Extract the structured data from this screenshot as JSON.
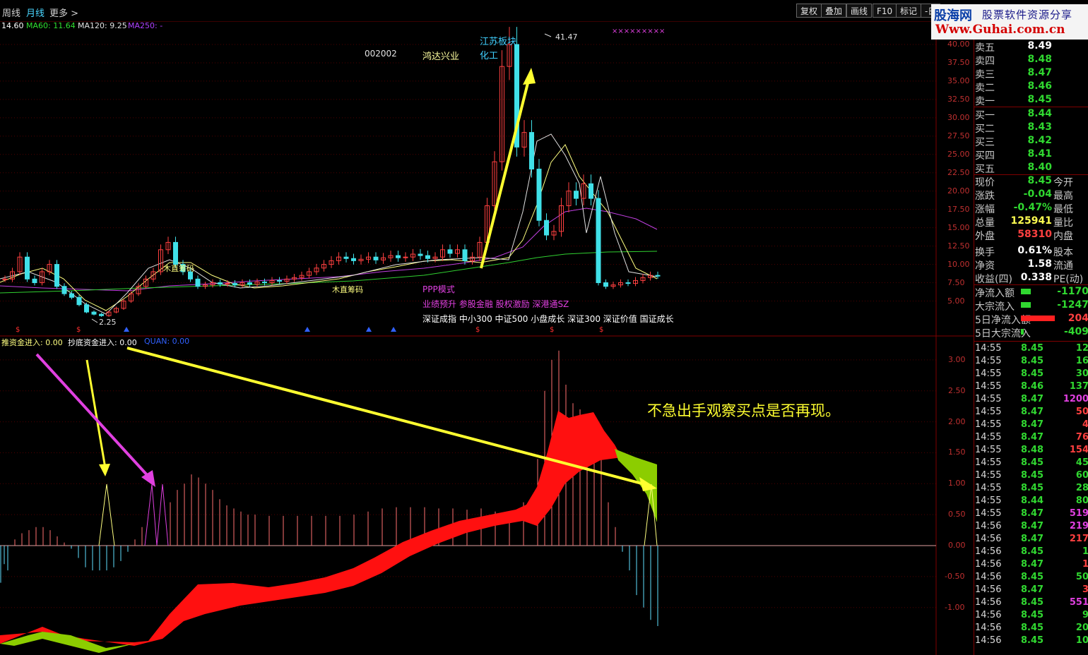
{
  "toolbar": {
    "tabs": [
      "周线",
      "月线",
      "更多 >"
    ],
    "buttons": [
      "复权",
      "叠加",
      "画线",
      "F10",
      "标记",
      "-日"
    ]
  },
  "logo": {
    "site": "股海网",
    "slogan": "股票软件资源分享",
    "url": "Www.Guhai.com.cn"
  },
  "ma_legend": {
    "ma30": "14.60",
    "ma60": "MA60: 11.64",
    "ma120": "MA120: 9.25",
    "ma250": "MA250: -"
  },
  "stock": {
    "code": "002002",
    "name": "鸿达兴业",
    "board": "江苏板块",
    "industry": "化工",
    "high_mark": "41.47",
    "low_mark": "2.25"
  },
  "annotations": {
    "label_a": "木直筹码",
    "label_b": "木直筹码",
    "ppp": "PPP模式",
    "concepts": "业绩预升 参股金融 股权激励 深港通SZ",
    "indices": "深证成指 中小300 中证500 小盘成长 深证300 深证价值 国证成长",
    "marks": "×××××××××",
    "comment": "不急出手观察买点是否再现。"
  },
  "indicator_legend": {
    "a": "推资金进入: 0.00",
    "b": "抄底资金进入: 0.00",
    "c": "QUAN: 0.00"
  },
  "price_axis": [
    "40.00",
    "37.50",
    "35.00",
    "32.50",
    "30.00",
    "27.50",
    "25.00",
    "22.50",
    "20.00",
    "17.50",
    "15.00",
    "12.50",
    "10.00",
    "7.50",
    "5.00"
  ],
  "ind_axis": [
    "3.00",
    "2.50",
    "2.00",
    "1.50",
    "1.00",
    "0.50",
    "0.00",
    "-0.50",
    "-1.00"
  ],
  "order_book": {
    "sell": [
      {
        "n": "卖五",
        "v": "8.49"
      },
      {
        "n": "卖四",
        "v": "8.48"
      },
      {
        "n": "卖三",
        "v": "8.47"
      },
      {
        "n": "卖二",
        "v": "8.46"
      },
      {
        "n": "卖一",
        "v": "8.45"
      }
    ],
    "buy": [
      {
        "n": "买一",
        "v": "8.44"
      },
      {
        "n": "买二",
        "v": "8.43"
      },
      {
        "n": "买三",
        "v": "8.42"
      },
      {
        "n": "买四",
        "v": "8.41"
      },
      {
        "n": "买五",
        "v": "8.40"
      }
    ]
  },
  "quote": [
    {
      "n": "现价",
      "v": "8.45",
      "e": "今开"
    },
    {
      "n": "涨跌",
      "v": "-0.04",
      "e": "最高"
    },
    {
      "n": "涨幅",
      "v": "-0.47%",
      "e": "最低"
    },
    {
      "n": "总量",
      "v": "125941",
      "e": "量比"
    },
    {
      "n": "外盘",
      "v": "58310",
      "e": "内盘"
    },
    {
      "n": "换手",
      "v": "0.61%",
      "e": "股本"
    },
    {
      "n": "净资",
      "v": "1.58",
      "e": "流通"
    },
    {
      "n": "收益(四)",
      "v": "0.338",
      "e": "PE(动)"
    }
  ],
  "flows": [
    {
      "n": "净流入额",
      "v": "-1170"
    },
    {
      "n": "大宗流入",
      "v": "-1247"
    },
    {
      "n": "5日净流入额",
      "v": "204"
    },
    {
      "n": "5日大宗流入",
      "v": "-409"
    }
  ],
  "ticks": [
    {
      "t": "14:55",
      "p": "8.45",
      "q": "12"
    },
    {
      "t": "14:55",
      "p": "8.45",
      "q": "16"
    },
    {
      "t": "14:55",
      "p": "8.45",
      "q": "30"
    },
    {
      "t": "14:55",
      "p": "8.46",
      "q": "137"
    },
    {
      "t": "14:55",
      "p": "8.47",
      "q": "1200"
    },
    {
      "t": "14:55",
      "p": "8.47",
      "q": "50"
    },
    {
      "t": "14:55",
      "p": "8.47",
      "q": "4"
    },
    {
      "t": "14:55",
      "p": "8.47",
      "q": "76"
    },
    {
      "t": "14:55",
      "p": "8.48",
      "q": "154"
    },
    {
      "t": "14:55",
      "p": "8.45",
      "q": "45"
    },
    {
      "t": "14:55",
      "p": "8.45",
      "q": "60"
    },
    {
      "t": "14:55",
      "p": "8.45",
      "q": "28"
    },
    {
      "t": "14:55",
      "p": "8.44",
      "q": "80"
    },
    {
      "t": "14:55",
      "p": "8.47",
      "q": "519"
    },
    {
      "t": "14:56",
      "p": "8.47",
      "q": "219"
    },
    {
      "t": "14:56",
      "p": "8.47",
      "q": "217"
    },
    {
      "t": "14:56",
      "p": "8.45",
      "q": "1"
    },
    {
      "t": "14:56",
      "p": "8.47",
      "q": "1"
    },
    {
      "t": "14:56",
      "p": "8.45",
      "q": "50"
    },
    {
      "t": "14:56",
      "p": "8.47",
      "q": "3"
    },
    {
      "t": "14:56",
      "p": "8.45",
      "q": "551"
    },
    {
      "t": "14:56",
      "p": "8.45",
      "q": "9"
    },
    {
      "t": "14:56",
      "p": "8.45",
      "q": "20"
    },
    {
      "t": "14:56",
      "p": "8.45",
      "q": "10"
    }
  ],
  "colors": {
    "up": "#ff4040",
    "down": "#40e0e8",
    "yellow": "#ffff30",
    "magenta": "#e040e0",
    "green_fill": "#8ccd00"
  }
}
